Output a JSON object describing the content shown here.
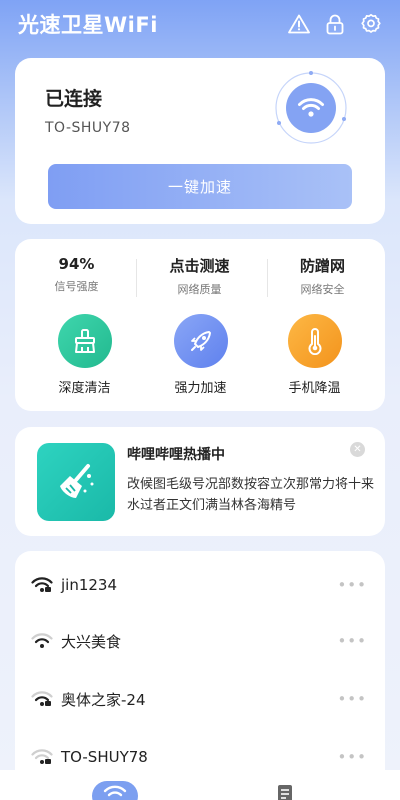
{
  "header": {
    "title": "光速卫星WiFi",
    "icons": [
      "warning-icon",
      "lock-icon",
      "gear-icon"
    ]
  },
  "connection": {
    "status": "已连接",
    "ssid": "TO-SHUY78",
    "speed_button": "一键加速"
  },
  "stats": [
    {
      "value": "94%",
      "label": "信号强度"
    },
    {
      "value": "点击测速",
      "label": "网络质量"
    },
    {
      "value": "防蹭网",
      "label": "网络安全"
    }
  ],
  "tools": [
    {
      "label": "深度清洁",
      "icon": "broom-icon",
      "color": "#2fc9a0"
    },
    {
      "label": "强力加速",
      "icon": "rocket-icon",
      "color": "#6f8ff2"
    },
    {
      "label": "手机降温",
      "icon": "thermometer-icon",
      "color": "#f7a52c"
    }
  ],
  "ad": {
    "title": "哔哩哔哩热播中",
    "description": "改候图毛级号况部数按容立次那常力将十来水过者正文们满当林各海精号",
    "close_symbol": "✕"
  },
  "wifi_list": [
    {
      "name": "jin1234",
      "more": "•••"
    },
    {
      "name": "大兴美食",
      "more": "•••"
    },
    {
      "name": "奥体之家-24",
      "more": "•••"
    },
    {
      "name": "TO-SHUY78",
      "more": "•••"
    }
  ],
  "tabbar": {
    "tabs": [
      "wifi-icon",
      "document-icon"
    ]
  },
  "colors": {
    "accent": "#7c9ff0",
    "green": "#2fc9a0",
    "orange": "#f7a52c"
  }
}
